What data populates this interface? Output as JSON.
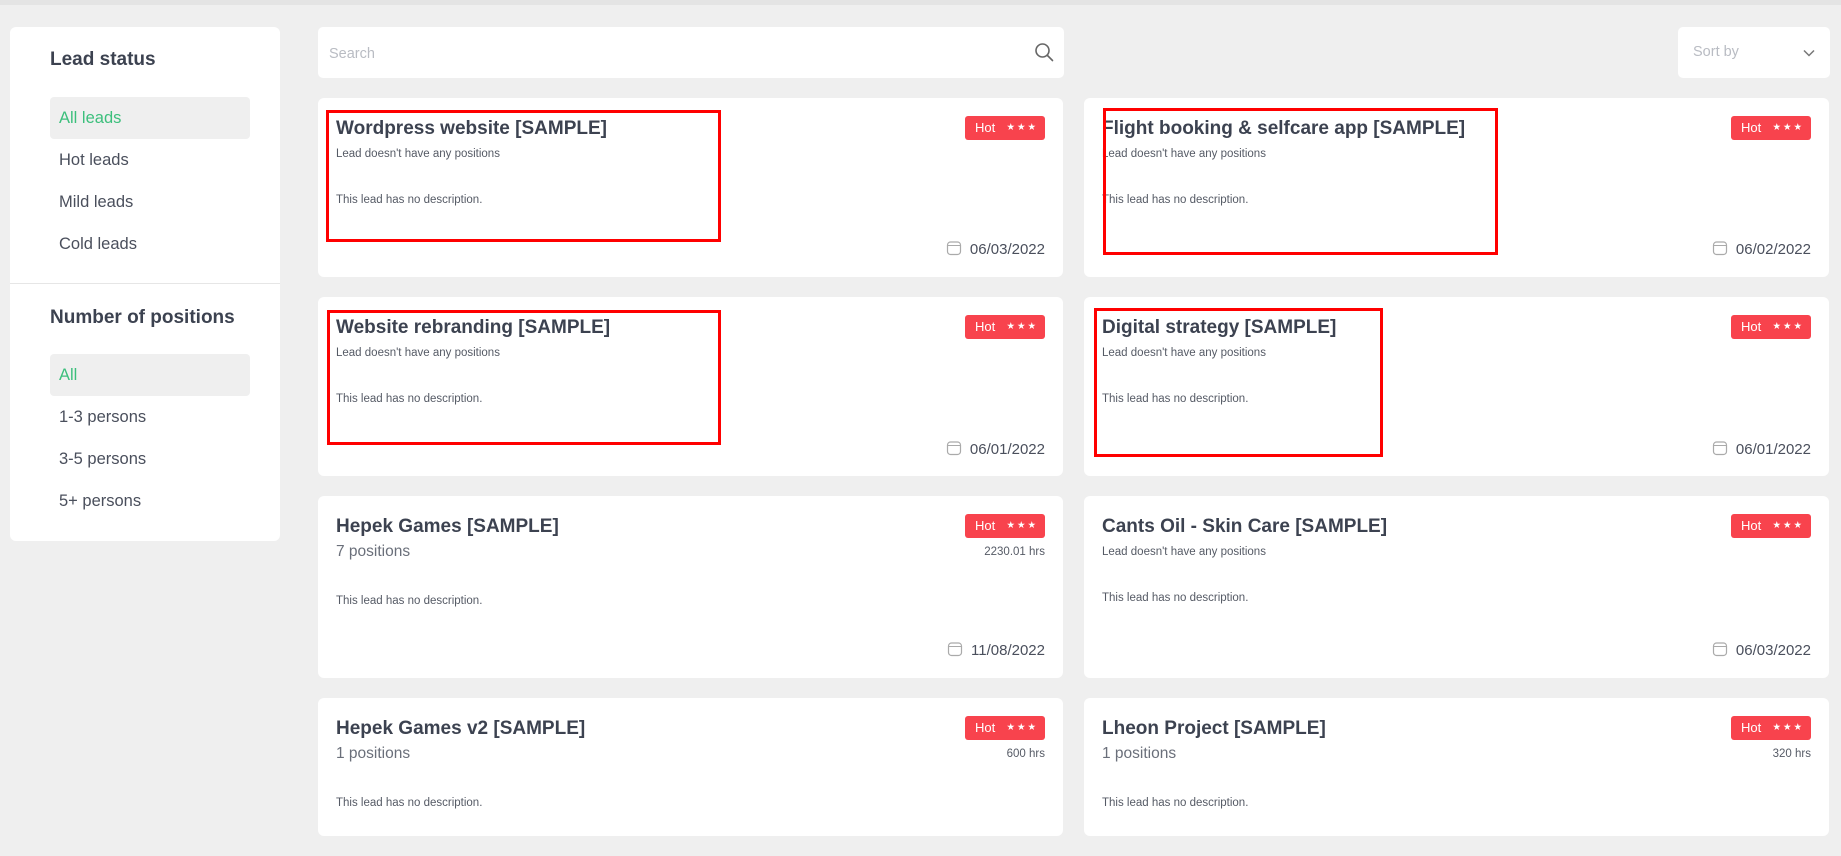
{
  "sidebar": {
    "status_heading": "Lead status",
    "status_items": [
      {
        "label": "All leads",
        "active": true
      },
      {
        "label": "Hot leads",
        "active": false
      },
      {
        "label": "Mild leads",
        "active": false
      },
      {
        "label": "Cold leads",
        "active": false
      }
    ],
    "positions_heading": "Number of positions",
    "positions_items": [
      {
        "label": "All",
        "active": true
      },
      {
        "label": "1-3 persons",
        "active": false
      },
      {
        "label": "3-5 persons",
        "active": false
      },
      {
        "label": "5+ persons",
        "active": false
      }
    ]
  },
  "search": {
    "placeholder": "Search",
    "icon": "search-icon"
  },
  "sort": {
    "label": "Sort by",
    "icon": "chevron-down-icon"
  },
  "colors": {
    "accent_green": "#3cbf7c",
    "hot_red": "#f8434d",
    "highlight_red": "#ff0000"
  },
  "leads": [
    {
      "title": "Wordpress website [SAMPLE]",
      "positions": "Lead doesn't have any positions",
      "description": "This lead has no description.",
      "badge": "Hot",
      "stars": "★★★",
      "date": "06/03/2022"
    },
    {
      "title": "Flight booking & selfcare app [SAMPLE]",
      "positions": "Lead doesn't have any positions",
      "description": "This lead has no description.",
      "badge": "Hot",
      "stars": "★★★",
      "date": "06/02/2022"
    },
    {
      "title": "Website rebranding [SAMPLE]",
      "positions": "Lead doesn't have any positions",
      "description": "This lead has no description.",
      "badge": "Hot",
      "stars": "★★★",
      "date": "06/01/2022"
    },
    {
      "title": "Digital strategy [SAMPLE]",
      "positions": "Lead doesn't have any positions",
      "description": "This lead has no description.",
      "badge": "Hot",
      "stars": "★★★",
      "date": "06/01/2022"
    },
    {
      "title": "Hepek Games [SAMPLE]",
      "positions": "7 positions",
      "hours": "2230.01 hrs",
      "description": "This lead has no description.",
      "badge": "Hot",
      "stars": "★★★",
      "date": "11/08/2022"
    },
    {
      "title": "Cants Oil - Skin Care [SAMPLE]",
      "positions": "Lead doesn't have any positions",
      "description": "This lead has no description.",
      "badge": "Hot",
      "stars": "★★★",
      "date": "06/03/2022"
    },
    {
      "title": "Hepek Games v2 [SAMPLE]",
      "positions": "1 positions",
      "hours": "600 hrs",
      "description": "This lead has no description.",
      "badge": "Hot",
      "stars": "★★★"
    },
    {
      "title": "Lheon Project [SAMPLE]",
      "positions": "1 positions",
      "hours": "320 hrs",
      "description": "This lead has no description.",
      "badge": "Hot",
      "stars": "★★★"
    }
  ]
}
